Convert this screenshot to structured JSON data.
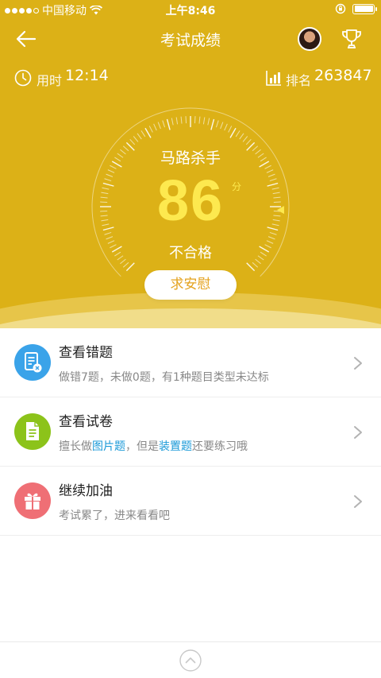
{
  "statusbar": {
    "carrier": "中国移动",
    "time": "上午8:46"
  },
  "navbar": {
    "title": "考试成绩",
    "back_icon": "arrow-left-icon",
    "trophy_icon": "trophy-icon"
  },
  "info": {
    "time_label": "用时",
    "time_value": "12:14",
    "rank_label": "排名",
    "rank_value": "263847"
  },
  "score": {
    "title": "马路杀手",
    "value": "86",
    "unit": "分",
    "result": "不合格",
    "comfort_button": "求安慰"
  },
  "colors": {
    "hero_bg": "#dcb117",
    "score": "#fde94f",
    "button_text": "#e4a21e",
    "link_blue": "#1b9ad8",
    "icon_blue": "#3aa3e9",
    "icon_green": "#8cc31a",
    "icon_red": "#ef6f75"
  },
  "list": [
    {
      "title": "查看错题",
      "subtitle": "做错7题，未做0题，有1种题目类型未达标",
      "icon": "wrong-answers-icon"
    },
    {
      "title": "查看试卷",
      "subtitle_pre": "擅长做",
      "subtitle_hl1": "图片题",
      "subtitle_mid": "，但是",
      "subtitle_hl2": "装置题",
      "subtitle_post": "还要练习哦",
      "icon": "document-icon"
    },
    {
      "title": "继续加油",
      "subtitle": "考试累了，进来看看吧",
      "icon": "gift-icon"
    }
  ],
  "bottom": {
    "icon": "chevron-up-circle-icon"
  }
}
